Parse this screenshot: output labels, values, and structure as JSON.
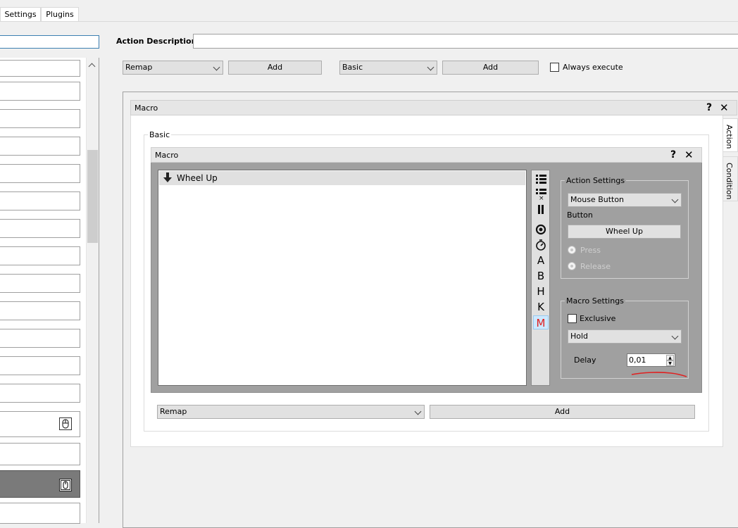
{
  "menu_tabs": [
    "Settings",
    "Plugins"
  ],
  "action_description": {
    "label": "Action Description",
    "value": ""
  },
  "top_row": {
    "combo1": "Remap",
    "add1": "Add",
    "combo2": "Basic",
    "add2": "Add",
    "always_execute": "Always execute"
  },
  "outer_macro": {
    "title": "Macro",
    "help": "?",
    "close": "✕"
  },
  "side_tabs": [
    "Action",
    "Condition"
  ],
  "basic_group": {
    "label": "Basic"
  },
  "inner_macro": {
    "title": "Macro",
    "help": "?",
    "close": "✕"
  },
  "macro_list": [
    {
      "icon": "arrow-down-icon",
      "label": "Wheel Up"
    }
  ],
  "toolbar": {
    "letters": [
      "A",
      "B",
      "H",
      "K",
      "M"
    ]
  },
  "action_settings": {
    "label": "Action Settings",
    "type": "Mouse Button",
    "button_label": "Button",
    "button_value": "Wheel Up",
    "press": "Press",
    "release": "Release"
  },
  "macro_settings": {
    "label": "Macro Settings",
    "exclusive": "Exclusive",
    "mode": "Hold",
    "delay_label": "Delay",
    "delay_value": "0,01"
  },
  "bottom_row": {
    "combo": "Remap",
    "add": "Add"
  },
  "colors": {
    "accent_red": "#e02020",
    "selected_dark": "#7a7a7a"
  }
}
